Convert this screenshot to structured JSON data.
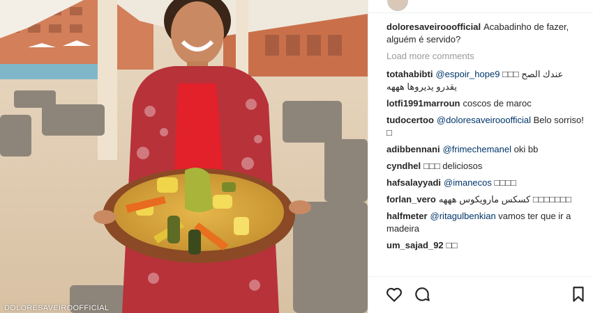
{
  "photo": {
    "watermark": "DOLORESAVEIROOFFICIAL"
  },
  "caption": {
    "user": "doloresaveirooofficial",
    "text": "Acabadinho de fazer, alguém é servido?"
  },
  "load_more": "Load more comments",
  "comments": [
    {
      "user": "totahabibti",
      "mention": "@espoir_hope9",
      "text": " □□□ عندك الصح",
      "text2": "يقدرو يديروها هههه"
    },
    {
      "user": "lotfi1991marroun",
      "mention": "",
      "text": "coscos de maroc",
      "text2": ""
    },
    {
      "user": "tudocertoo",
      "mention": "@doloresaveirooofficial",
      "text": " Belo sorriso! □",
      "text2": ""
    },
    {
      "user": "adibbennani",
      "mention": "@frimechemanel",
      "text": " oki bb",
      "text2": ""
    },
    {
      "user": "cyndhel",
      "mention": "",
      "text": "□□□ deliciosos",
      "text2": ""
    },
    {
      "user": "hafsalayyadi",
      "mention": "@imanecos",
      "text": " □□□□",
      "text2": ""
    },
    {
      "user": "forlan_vero",
      "mention": "",
      "text": "كسكس مارويكوس هههه □□□□□□□",
      "text2": ""
    },
    {
      "user": "halfmeter",
      "mention": "@ritagulbenkian",
      "text": " vamos ter que ir a madeira",
      "text2": ""
    },
    {
      "user": "um_sajad_92",
      "mention": "",
      "text": "□□",
      "text2": ""
    }
  ],
  "icons": {
    "like": "heart-icon",
    "comment": "comment-icon",
    "save": "bookmark-icon"
  }
}
